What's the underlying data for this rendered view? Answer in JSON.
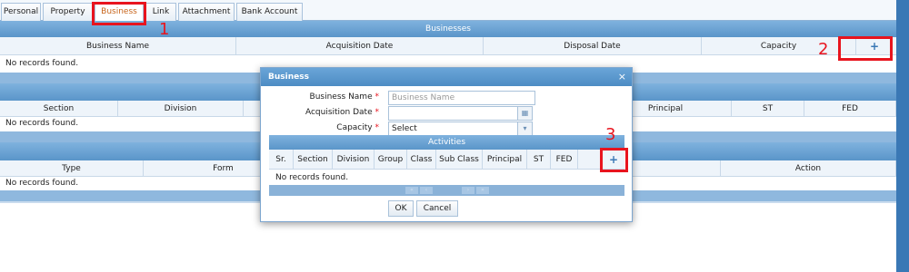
{
  "tabs": [
    {
      "label": "Personal"
    },
    {
      "label": "Property"
    },
    {
      "label": "Business"
    },
    {
      "label": "Link"
    },
    {
      "label": "Attachment"
    },
    {
      "label": "Bank Account"
    }
  ],
  "businesses": {
    "title": "Businesses",
    "columns": [
      "Business Name",
      "Acquisition Date",
      "Disposal Date",
      "Capacity"
    ],
    "add_icon": "plus-icon",
    "empty": "No records found."
  },
  "section2": {
    "columns": [
      "Section",
      "Division",
      "Principal",
      "ST",
      "FED"
    ],
    "empty": "No records found."
  },
  "section3": {
    "columns": [
      "Type",
      "Form",
      "Action"
    ],
    "empty": "No records found."
  },
  "annotations": [
    "1",
    "2",
    "3"
  ],
  "dialog": {
    "title": "Business",
    "close": "×",
    "fields": {
      "business_name": {
        "label": "Business Name",
        "placeholder": "Business Name"
      },
      "acquisition_date": {
        "label": "Acquisition Date"
      },
      "capacity": {
        "label": "Capacity",
        "value": "Select"
      }
    },
    "required_mark": "*",
    "activities": {
      "title": "Activities",
      "columns": [
        "Sr.",
        "Section",
        "Division",
        "Group",
        "Class",
        "Sub Class",
        "Principal",
        "ST",
        "FED"
      ],
      "empty": "No records found."
    },
    "ok": "OK",
    "cancel": "Cancel"
  },
  "colors": {
    "accent": "#5a95c9",
    "annotation": "#e8141e",
    "active_tab_text": "#c8651c"
  }
}
